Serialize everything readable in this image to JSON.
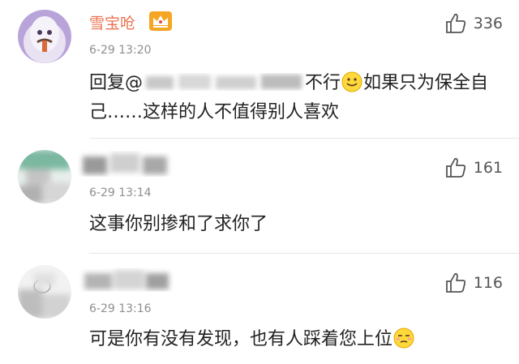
{
  "comments": [
    {
      "username": "雪宝呛",
      "badge": "crown-icon",
      "time": "6-29 13:20",
      "likes": "336",
      "text_prefix": "回复@",
      "text_tail_1": "不行",
      "text_tail_2": "如果只为保全自",
      "text_line2": "己……这样的人不值得别人喜欢",
      "emoji": "smile-emoji-icon"
    },
    {
      "username": "",
      "time": "6-29 13:14",
      "likes": "161",
      "text": "这事你别掺和了求你了"
    },
    {
      "username": "",
      "time": "6-29 13:16",
      "likes": "116",
      "text": "可是你有没有发现，也有人踩着您上位",
      "emoji": "unamused-emoji-icon"
    }
  ],
  "colors": {
    "vip_name": "#eb7350",
    "timestamp": "#8f8f8f",
    "divider": "#e6e6e6",
    "text": "#222222"
  }
}
